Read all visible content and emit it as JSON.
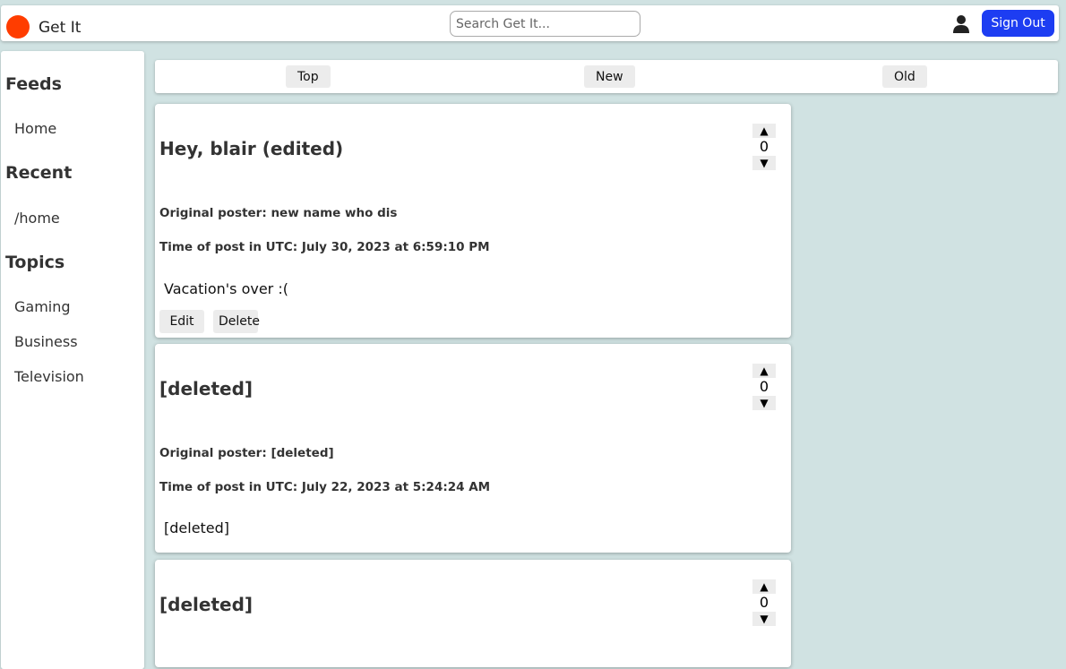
{
  "header": {
    "brand": "Get It",
    "search_placeholder": "Search Get It...",
    "signout_label": "Sign Out",
    "logo_color": "#ff3d00",
    "accent": "#1d3df2"
  },
  "sidebar": {
    "feeds_heading": "Feeds",
    "feeds": [
      "Home"
    ],
    "recent_heading": "Recent",
    "recent": [
      "/home"
    ],
    "topics_heading": "Topics",
    "topics": [
      "Gaming",
      "Business",
      "Television"
    ]
  },
  "sort": {
    "top": "Top",
    "new": "New",
    "old": "Old"
  },
  "posts": [
    {
      "title": "Hey, blair (edited)",
      "poster": "Original poster: new name who dis",
      "time": "Time of post in UTC: July 30, 2023 at 6:59:10 PM",
      "body": "Vacation's over :(",
      "votes": "0",
      "edit_label": "Edit",
      "delete_label": "Delete"
    },
    {
      "title": "[deleted]",
      "poster": "Original poster: [deleted]",
      "time": "Time of post in UTC: July 22, 2023 at 5:24:24 AM",
      "body": "[deleted]",
      "votes": "0"
    },
    {
      "title": "[deleted]",
      "votes": "0"
    }
  ],
  "vote_up": "▲",
  "vote_down": "▼"
}
